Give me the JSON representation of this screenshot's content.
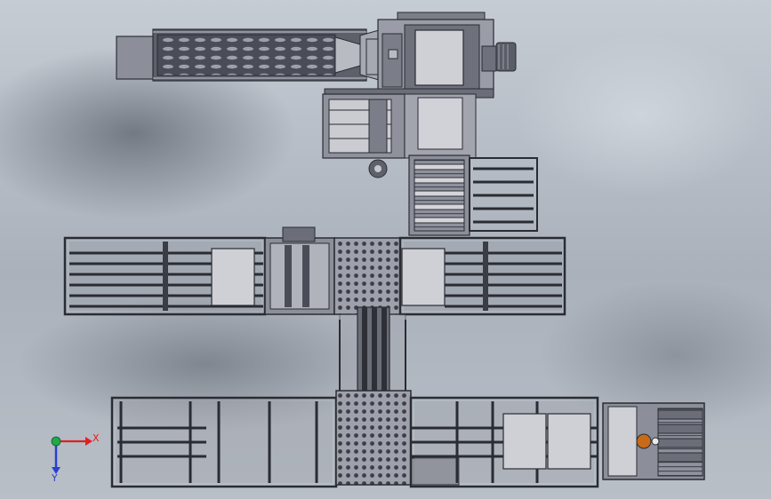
{
  "triad": {
    "x_label": "X",
    "y_label": "Y",
    "x_color": "#e02020",
    "y_color": "#2a3fd0",
    "origin_color": "#21a84a"
  },
  "model": {
    "frame_color": "#3a3d46",
    "steel_color": "#8c8f9a",
    "plate_color": "#c9cad0",
    "accent_color": "#c86a1a",
    "subassemblies": [
      "infeed-hopper",
      "top-rotary-transfer",
      "side-roller-table",
      "middle-left-conveyor",
      "middle-center-transfer",
      "middle-right-conveyor",
      "vertical-link-conveyor",
      "bottom-left-conveyor",
      "bottom-center-transfer",
      "bottom-right-conveyor",
      "outfeed-drive-unit"
    ]
  }
}
